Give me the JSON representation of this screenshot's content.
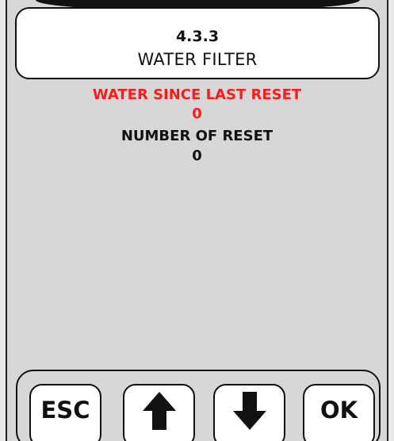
{
  "header": {
    "menu_code": "4.3.3",
    "title": "WATER FILTER"
  },
  "info": {
    "water_since_reset_label": "WATER SINCE LAST RESET",
    "water_since_reset_value": "0",
    "number_of_reset_label": "NUMBER OF RESET",
    "number_of_reset_value": "0"
  },
  "buttons": {
    "esc_label": "ESC",
    "up_icon": "arrow-up-icon",
    "down_icon": "arrow-down-icon",
    "ok_label": "OK"
  },
  "colors": {
    "highlight": "#ff1a1a",
    "text": "#111111",
    "background": "#d7d7d7",
    "panel": "#ffffff"
  }
}
